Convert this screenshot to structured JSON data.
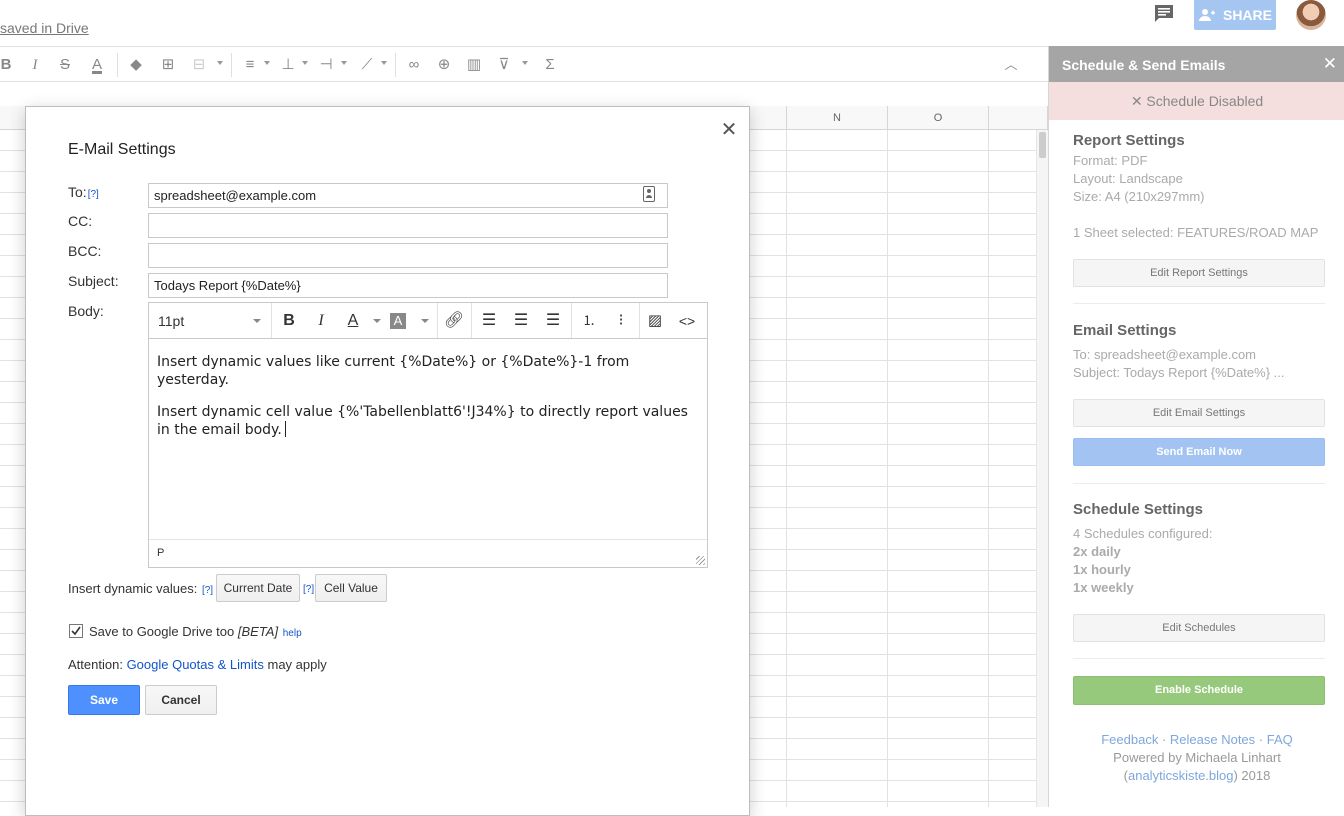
{
  "topbar": {
    "saved_text": "saved in Drive",
    "share_label": "SHARE"
  },
  "grid": {
    "columns": [
      "N",
      "O"
    ]
  },
  "dialog": {
    "title": "E-Mail Settings",
    "to_label": "To:",
    "help_marker": "[?]",
    "cc_label": "CC:",
    "bcc_label": "BCC:",
    "subject_label": "Subject:",
    "body_label": "Body:",
    "to_value": "spreadsheet@example.com",
    "cc_value": "",
    "bcc_value": "",
    "subject_value": "Todays Report {%Date%}",
    "editor": {
      "font_size": "11pt",
      "paragraph_1": "Insert dynamic values like current {%Date%} or {%Date%}-1 from yesterday.",
      "paragraph_2": "Insert dynamic cell value {%'Tabellenblatt6'!J34%} to directly report values in the email body.",
      "status_path": "P"
    },
    "insert_dynamic_label": "Insert dynamic values:",
    "current_date_button": "Current Date",
    "cell_value_button": "Cell Value",
    "save_to_drive_label": "Save to Google Drive too",
    "beta_label": "[BETA]",
    "help_link": "help",
    "save_to_drive_checked": true,
    "attention_prefix": "Attention:",
    "quotas_link": "Google Quotas & Limits",
    "attention_suffix": "may apply",
    "save_button": "Save",
    "cancel_button": "Cancel"
  },
  "sidebar": {
    "title": "Schedule & Send Emails",
    "status": "✕ Schedule Disabled",
    "report": {
      "heading": "Report Settings",
      "format": "Format: PDF",
      "layout": "Layout: Landscape",
      "size": "Size: A4 (210x297mm)",
      "sheets": "1 Sheet selected: FEATURES/ROAD MAP",
      "edit_button": "Edit Report Settings"
    },
    "email": {
      "heading": "Email Settings",
      "to": "To: spreadsheet@example.com",
      "subject": "Subject: Todays Report {%Date%} ...",
      "edit_button": "Edit Email Settings",
      "send_button": "Send Email Now"
    },
    "schedule": {
      "heading": "Schedule Settings",
      "configured": "4 Schedules configured:",
      "items": [
        "2x daily",
        "1x hourly",
        "1x weekly"
      ],
      "edit_button": "Edit Schedules",
      "enable_button": "Enable Schedule"
    },
    "footer": {
      "feedback": "Feedback",
      "release_notes": "Release Notes",
      "faq": "FAQ",
      "separator": " · ",
      "powered_by": "Powered by Michaela Linhart",
      "blog_open": "(",
      "blog_link": "analyticskiste.blog",
      "blog_close": ") 2018"
    }
  }
}
